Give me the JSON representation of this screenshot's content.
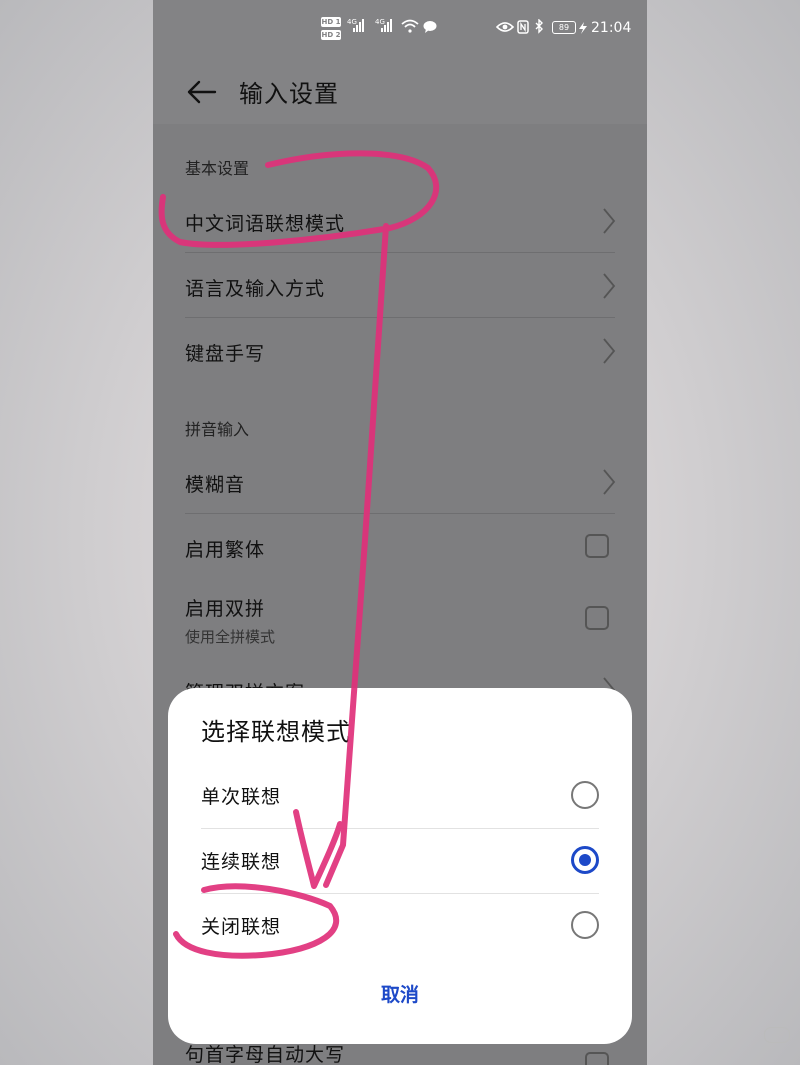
{
  "status_bar": {
    "time": "21:04",
    "battery": "89",
    "hd_badges": [
      "HD 1",
      "HD 2"
    ],
    "network_labels": [
      "4G",
      "4G"
    ]
  },
  "header": {
    "title": "输入设置",
    "back_icon": "arrow-left-icon"
  },
  "sections": [
    {
      "header": "基本设置",
      "rows": [
        {
          "label": "中文词语联想模式",
          "control": "chevron"
        },
        {
          "label": "语言及输入方式",
          "control": "chevron"
        },
        {
          "label": "键盘手写",
          "control": "chevron"
        }
      ]
    },
    {
      "header": "拼音输入",
      "rows": [
        {
          "label": "模糊音",
          "control": "chevron"
        },
        {
          "label": "启用繁体",
          "control": "checkbox",
          "checked": false
        },
        {
          "label": "启用双拼",
          "sublabel": "使用全拼模式",
          "control": "checkbox",
          "checked": false
        },
        {
          "label": "管理双拼方案",
          "control": "chevron"
        }
      ]
    }
  ],
  "bottom_row": {
    "label": "句首字母自动大写",
    "control": "checkbox",
    "checked": false
  },
  "dialog": {
    "title": "选择联想模式",
    "options": [
      {
        "label": "单次联想",
        "selected": false
      },
      {
        "label": "连续联想",
        "selected": true
      },
      {
        "label": "关闭联想",
        "selected": false
      }
    ],
    "cancel_label": "取消"
  },
  "colors": {
    "accent": "#1d49c8",
    "annotation": "#e0307a",
    "dim_overlay": "#7e7e80"
  }
}
